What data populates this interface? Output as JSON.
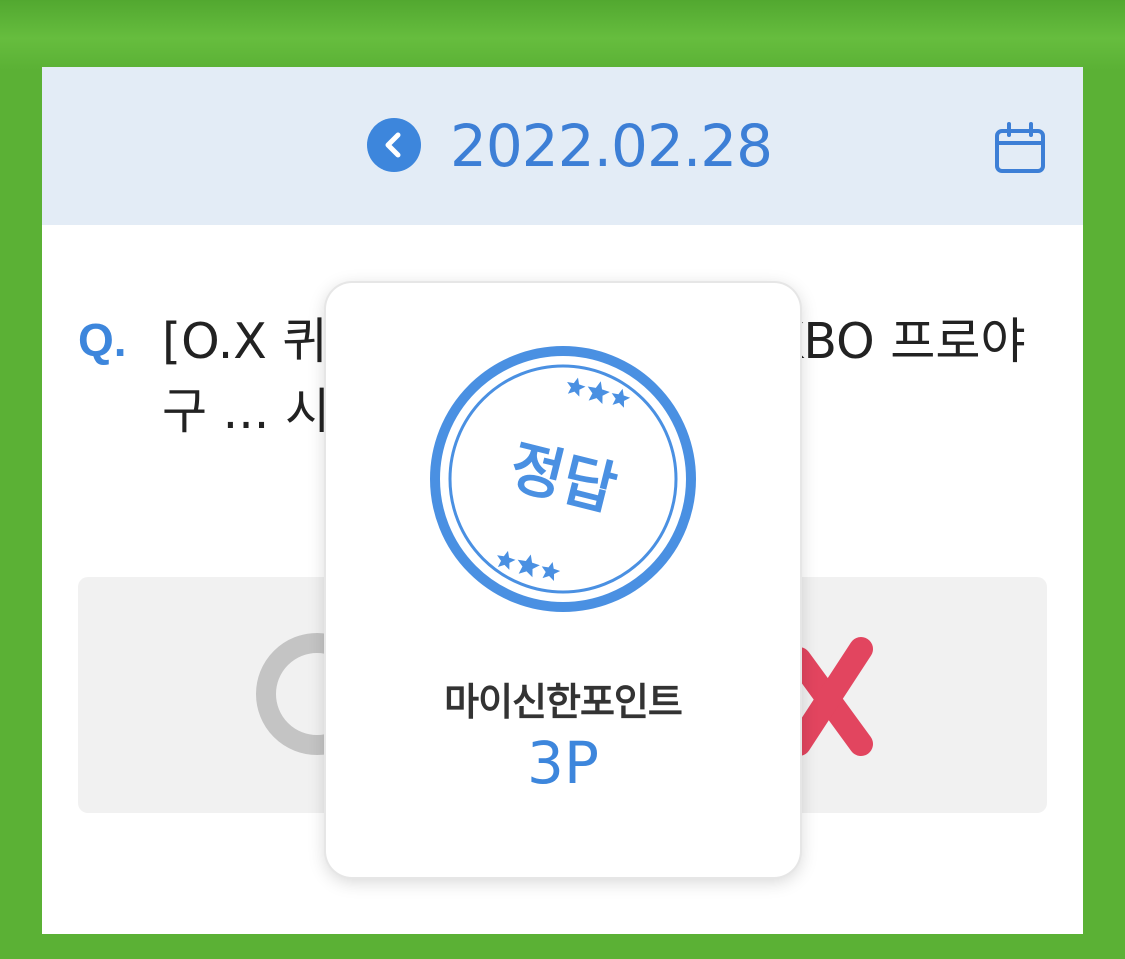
{
  "header": {
    "date": "2022.02.28",
    "prev_icon": "chevron-left-icon",
    "calendar_icon": "calendar-icon"
  },
  "question": {
    "label": "Q.",
    "text": "[O.X 퀴즈] 코로나19로 인해 KBO 프로야구 ... 시즌이 축소될 예정 ..."
  },
  "answers": {
    "o_icon": "circle-o-icon",
    "x_icon": "cross-x-icon"
  },
  "popup": {
    "stamp_text": "정답",
    "reward_label": "마이신한포인트",
    "reward_value": "3P"
  },
  "colors": {
    "accent": "#3d86dc",
    "stamp": "#4a90e2",
    "x_red": "#e2455f",
    "o_gray": "#c4c4c4",
    "grass": "#5bb135"
  }
}
